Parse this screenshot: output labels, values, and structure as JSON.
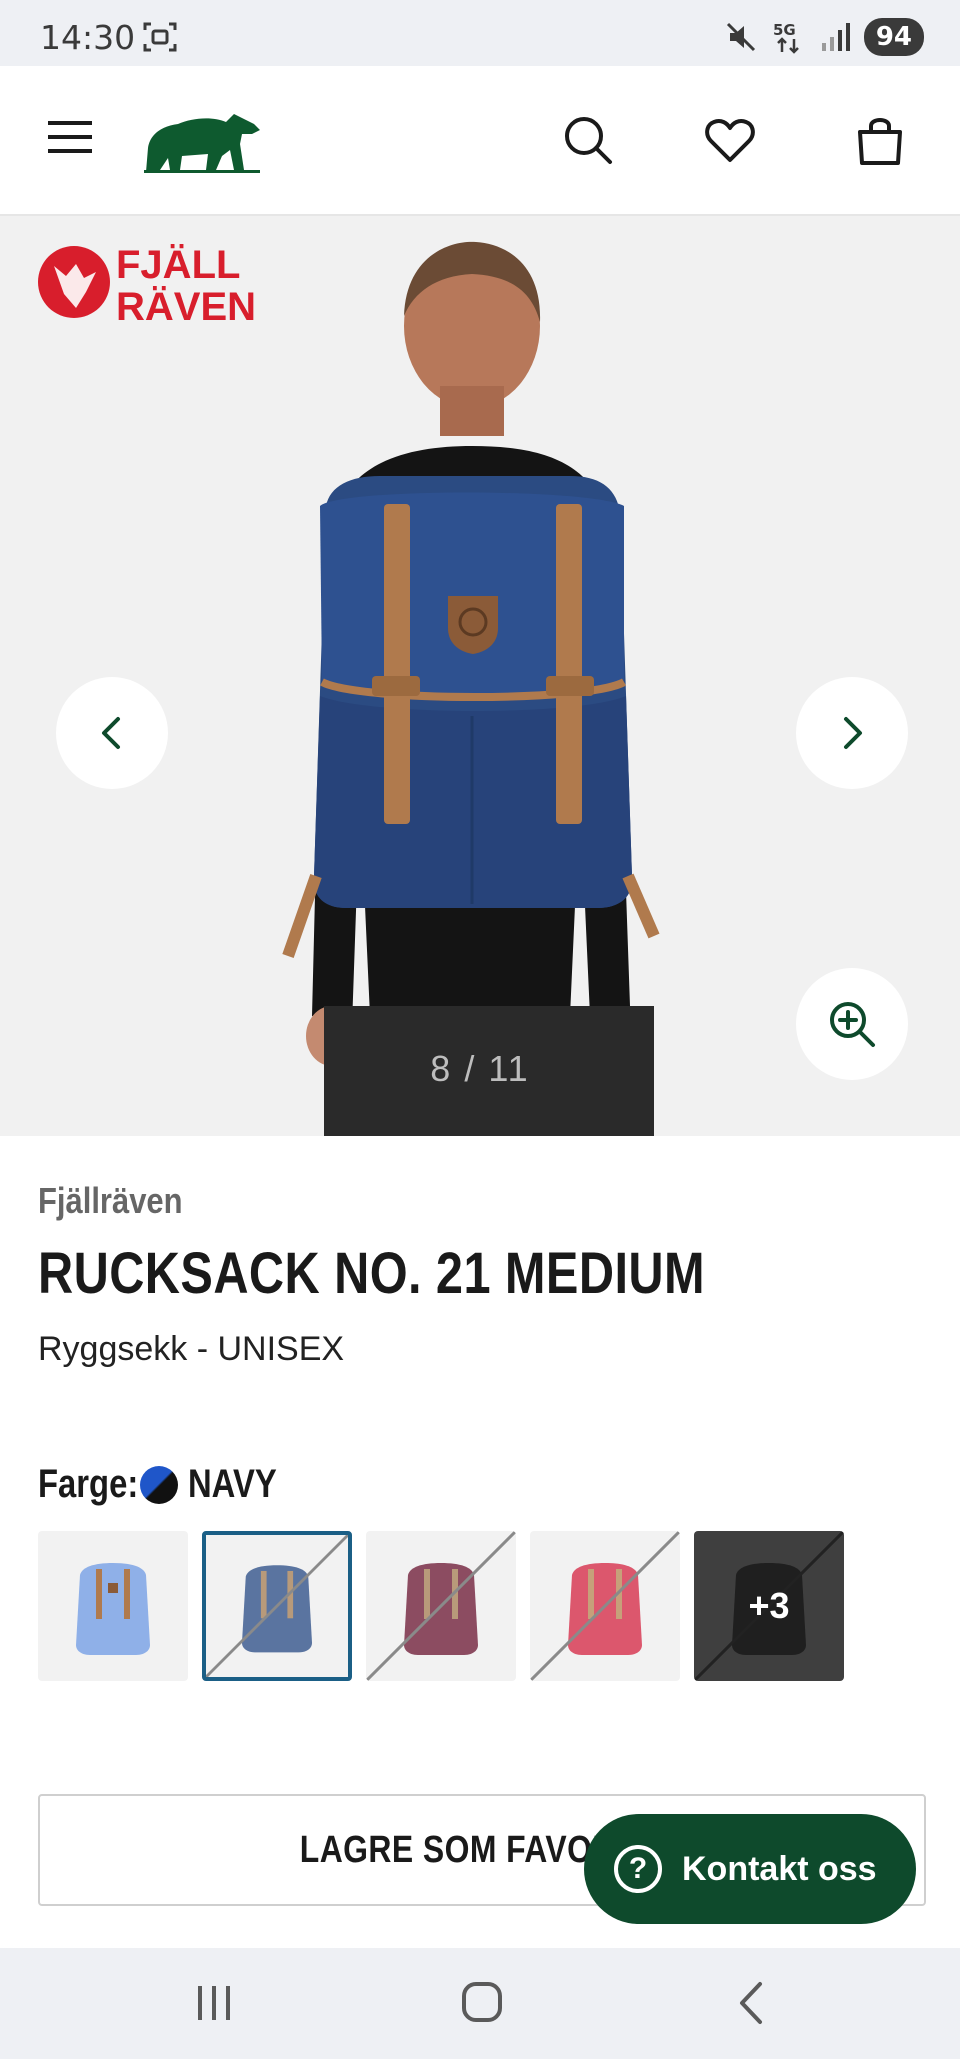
{
  "status_bar": {
    "time": "14:30",
    "battery": "94",
    "network": "5G",
    "icons": [
      "screenshot-icon",
      "mute-icon",
      "5g-icon",
      "signal-icon"
    ]
  },
  "header": {
    "icons": [
      "menu-icon",
      "bear-logo",
      "search-icon",
      "heart-icon",
      "bag-icon"
    ]
  },
  "gallery": {
    "counter": "8 / 11",
    "icons": [
      "fjallraven-logo",
      "chevron-left-icon",
      "chevron-right-icon",
      "zoom-in-icon"
    ]
  },
  "product": {
    "brand": "Fjällräven",
    "title": "RUCKSACK NO. 21 MEDIUM",
    "subtitle": "Ryggsekk - UNISEX"
  },
  "color": {
    "label": "Farge:",
    "value": "NAVY",
    "swatches": [
      {
        "color": "#8fb0e8",
        "available": true,
        "selected": false
      },
      {
        "color": "#5a74a0",
        "available": false,
        "selected": true
      },
      {
        "color": "#7a2f48",
        "available": false,
        "selected": false
      },
      {
        "color": "#d9465e",
        "available": false,
        "selected": false
      }
    ],
    "more_label": "+3"
  },
  "actions": {
    "favorite_label": "LAGRE SOM FAVORITT",
    "contact_label": "Kontakt oss"
  },
  "colors": {
    "brand_green": "#0e4a2c",
    "fjallraven_red": "#d81e2c",
    "selected_border": "#1b5f86"
  }
}
